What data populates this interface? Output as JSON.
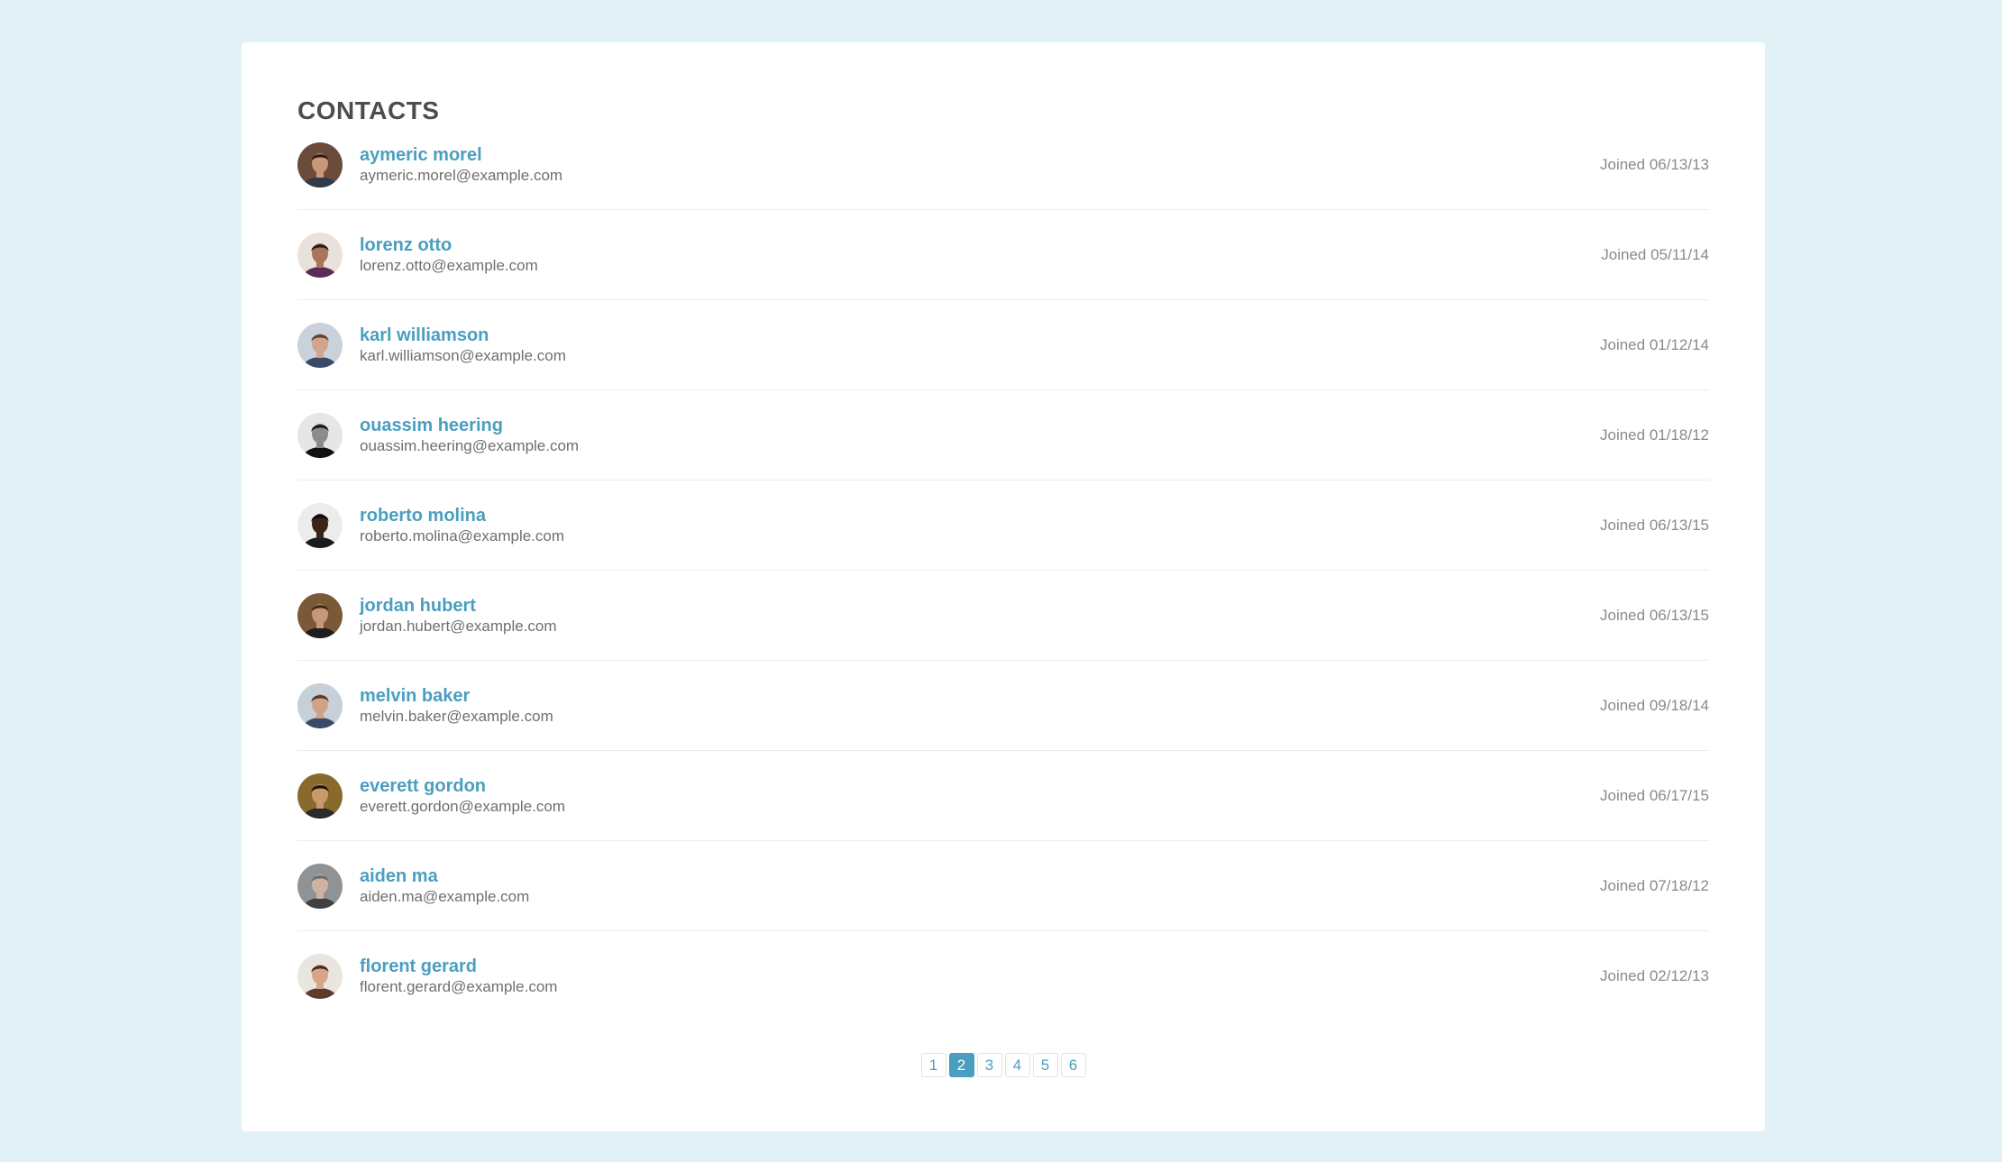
{
  "title": "CONTACTS",
  "accent_color": "#4a9ec0",
  "contacts": [
    {
      "name": "aymeric morel",
      "email": "aymeric.morel@example.com",
      "joined": "Joined 06/13/13",
      "avatar": {
        "bg": "#6b4b3a",
        "skin": "#c89877",
        "hair": "#2c1f18",
        "shirt": "#2f3a4a"
      }
    },
    {
      "name": "lorenz otto",
      "email": "lorenz.otto@example.com",
      "joined": "Joined 05/11/14",
      "avatar": {
        "bg": "#e9e2dc",
        "skin": "#a8755a",
        "hair": "#2b1b14",
        "shirt": "#5b2d55"
      }
    },
    {
      "name": "karl williamson",
      "email": "karl.williamson@example.com",
      "joined": "Joined 01/12/14",
      "avatar": {
        "bg": "#c9d2db",
        "skin": "#d2a58a",
        "hair": "#5a4436",
        "shirt": "#3b4a6a"
      }
    },
    {
      "name": "ouassim heering",
      "email": "ouassim.heering@example.com",
      "joined": "Joined 01/18/12",
      "avatar": {
        "bg": "#e6e6e6",
        "skin": "#8c8c8c",
        "hair": "#1a1a1a",
        "shirt": "#111111"
      }
    },
    {
      "name": "roberto molina",
      "email": "roberto.molina@example.com",
      "joined": "Joined 06/13/15",
      "avatar": {
        "bg": "#ececec",
        "skin": "#3b2418",
        "hair": "#120a06",
        "shirt": "#1b1b1b"
      }
    },
    {
      "name": "jordan hubert",
      "email": "jordan.hubert@example.com",
      "joined": "Joined 06/13/15",
      "avatar": {
        "bg": "#7a5a36",
        "skin": "#c79779",
        "hair": "#3a2a1c",
        "shirt": "#1d1d1d"
      }
    },
    {
      "name": "melvin baker",
      "email": "melvin.baker@example.com",
      "joined": "Joined 09/18/14",
      "avatar": {
        "bg": "#c7d0d8",
        "skin": "#d1a386",
        "hair": "#4e3b2e",
        "shirt": "#3a4a68"
      }
    },
    {
      "name": "everett gordon",
      "email": "everett.gordon@example.com",
      "joined": "Joined 06/17/15",
      "avatar": {
        "bg": "#8a6a2c",
        "skin": "#c8996d",
        "hair": "#1b1209",
        "shirt": "#2a2a2a"
      }
    },
    {
      "name": "aiden ma",
      "email": "aiden.ma@example.com",
      "joined": "Joined 07/18/12",
      "avatar": {
        "bg": "#8f9396",
        "skin": "#cfb2a0",
        "hair": "#6f6a66",
        "shirt": "#3d4144"
      }
    },
    {
      "name": "florent gerard",
      "email": "florent.gerard@example.com",
      "joined": "Joined 02/12/13",
      "avatar": {
        "bg": "#ebe5e0",
        "skin": "#d6a688",
        "hair": "#4a2d1d",
        "shirt": "#5b3b2b"
      }
    }
  ],
  "pagination": {
    "pages": [
      "1",
      "2",
      "3",
      "4",
      "5",
      "6"
    ],
    "current": "2"
  }
}
